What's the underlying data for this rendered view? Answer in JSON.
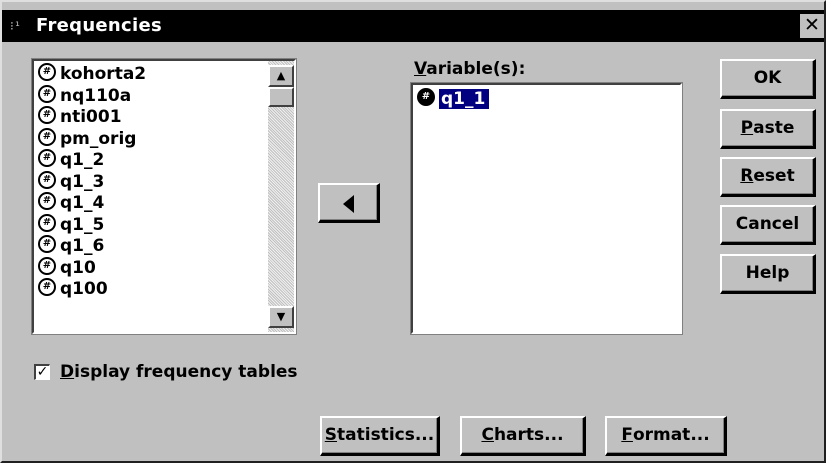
{
  "window": {
    "title": "Frequencies",
    "close_glyph": "✕"
  },
  "source_list": {
    "items": [
      {
        "name": "kohorta2",
        "icon": "numeric-variable-icon"
      },
      {
        "name": "nq110a",
        "icon": "numeric-variable-icon"
      },
      {
        "name": "nti001",
        "icon": "numeric-variable-icon"
      },
      {
        "name": "pm_orig",
        "icon": "numeric-variable-icon"
      },
      {
        "name": "q1_2",
        "icon": "numeric-variable-icon"
      },
      {
        "name": "q1_3",
        "icon": "numeric-variable-icon"
      },
      {
        "name": "q1_4",
        "icon": "numeric-variable-icon"
      },
      {
        "name": "q1_5",
        "icon": "numeric-variable-icon"
      },
      {
        "name": "q1_6",
        "icon": "numeric-variable-icon"
      },
      {
        "name": "q10",
        "icon": "numeric-variable-icon"
      },
      {
        "name": "q100",
        "icon": "numeric-variable-icon"
      }
    ],
    "icon_glyph": "#",
    "scroll_up_glyph": "▲",
    "scroll_down_glyph": "▼"
  },
  "variables": {
    "label_accel": "V",
    "label_rest": "ariable(s):",
    "items": [
      {
        "name": "q1_1",
        "selected": true,
        "icon": "numeric-variable-icon"
      }
    ]
  },
  "buttons": {
    "ok": "OK",
    "paste_accel": "P",
    "paste_rest": "aste",
    "reset_accel": "R",
    "reset_rest": "eset",
    "cancel": "Cancel",
    "help": "Help",
    "statistics_accel": "S",
    "statistics_rest": "tatistics...",
    "charts_accel": "C",
    "charts_rest": "harts...",
    "format_accel": "F",
    "format_rest": "ormat..."
  },
  "options": {
    "display_tables_accel": "D",
    "display_tables_rest": "isplay frequency tables",
    "display_tables_checked": true,
    "check_glyph": "✓"
  },
  "colors": {
    "dialog_bg": "#c0c0c0",
    "titlebar_bg": "#000000",
    "selection_bg": "#000080"
  }
}
